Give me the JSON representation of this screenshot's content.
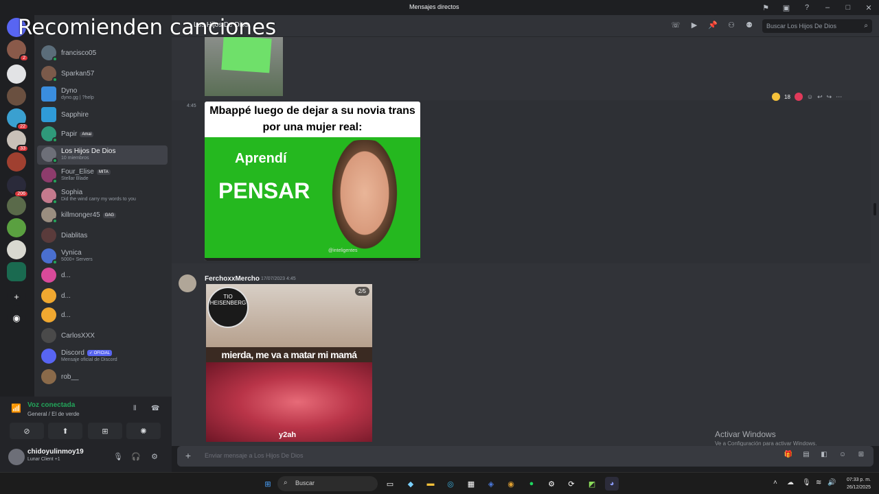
{
  "window": {
    "title": "Mensajes directos"
  },
  "overlay": {
    "caption": "Recomienden canciones"
  },
  "header": {
    "channel_name": "Los Hijos De Dios",
    "search_placeholder": "Buscar Los Hijos De Dios"
  },
  "servers": {
    "badges": [
      "2",
      "22",
      "33",
      "206"
    ]
  },
  "dms": [
    {
      "name": "francisco05",
      "sub": "",
      "color": "#5b6d7a"
    },
    {
      "name": "Sparkan57",
      "sub": "",
      "color": "#7b5a4a"
    },
    {
      "name": "Dyno",
      "sub": "dyno.gg | ?help",
      "color": "#3a8dde"
    },
    {
      "name": "Sapphire",
      "sub": "",
      "color": "#2f9bd8"
    },
    {
      "name": "Papir",
      "tag": "Amai",
      "sub": "",
      "color": "#2f9a7a"
    },
    {
      "name": "Los Hijos De Dios",
      "sub": "10 miembros",
      "color": "#6d6f78"
    },
    {
      "name": "Four_Elise",
      "tag": "MITA",
      "sub": "Stellar Blade",
      "color": "#8e3c6c"
    },
    {
      "name": "Sophia",
      "sub": "Did the wind carry my words to you",
      "color": "#c57a8d"
    },
    {
      "name": "killmonger45",
      "tag": "GAG",
      "sub": "",
      "color": "#9a8e80"
    },
    {
      "name": "Diablitas",
      "sub": "",
      "color": "#5a3b3b"
    },
    {
      "name": "Vynica",
      "sub": "5000+ Servers",
      "color": "#4a6fd0"
    },
    {
      "name": "d...",
      "sub": "",
      "color": "#d84a9a"
    },
    {
      "name": "d...",
      "sub": "",
      "color": "#f0a830"
    },
    {
      "name": "d...",
      "sub": "",
      "color": "#f0a830"
    },
    {
      "name": "CarlosXXX",
      "sub": "",
      "color": "#4a4a4a"
    },
    {
      "name": "Discord",
      "tag": "✓ OFICIAL",
      "sub": "Mensaje oficial de Discord",
      "color": "#5865f2"
    },
    {
      "name": "rob__",
      "sub": "",
      "color": "#8a6a4a"
    }
  ],
  "voice": {
    "title": "Voz conectada",
    "channel": "General / El de verde"
  },
  "user": {
    "name": "chidoyulinmoy19",
    "status": "Lunar Client +1"
  },
  "messages": {
    "first_time": "4:45",
    "meme1_caption": "Mbappé luego de dejar a su novia trans por una mujer real:",
    "meme1_word1": "Aprendí",
    "meme1_word2": "PENSAR",
    "meme1_watermark": "@inteligentes",
    "reaction_count": "18",
    "author": "FerchoxxMercho",
    "date": "17/07/2023 4:45",
    "meme2_caption": "mierda, me va a matar mi mamá",
    "meme2_logo": "TIO HEISENBERG",
    "meme2_counter": "2/5",
    "meme2_watermark": "y2ah"
  },
  "composer": {
    "placeholder": "Enviar mensaje a Los Hijos De Dios"
  },
  "activation": {
    "line1": "Activar Windows",
    "line2": "Ve a Configuración para activar Windows."
  },
  "taskbar": {
    "search": "Buscar",
    "time": "07:33 p. m.",
    "date": "26/12/2025"
  }
}
